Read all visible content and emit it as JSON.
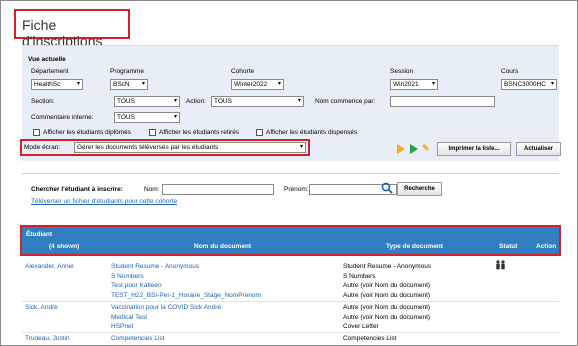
{
  "page": {
    "title": "Fiche d'inscriptions"
  },
  "filters": {
    "section_title": "Vue actuelle",
    "departement_label": "Département",
    "departement_value": "HealthSc",
    "programme_label": "Programme",
    "programme_value": "BScN",
    "cohorte_label": "Cohorte",
    "cohorte_value": "Winter2022",
    "session_label": "Session",
    "session_value": "Win2021",
    "cours_label": "Cours",
    "cours_value": "BSNC3000HC",
    "section_label": "Section:",
    "section_value": "TOUS",
    "action_label": "Action:",
    "action_value": "TOUS",
    "nom_commence_label": "Nom commence par:",
    "nom_commence_value": "",
    "commentaire_label": "Commentaire interne:",
    "commentaire_value": "TOUS",
    "chk_diplomes": "Afficher les étudiants diplômés",
    "chk_retires": "Afficher les étudiants retirés",
    "chk_dispenses": "Afficher les étudiants dispensés",
    "mode_label": "Mode écran:",
    "mode_value": "Gérer les documents téléversés par les étudiants",
    "print_button": "Imprimer la liste...",
    "refresh_button": "Actualiser"
  },
  "search": {
    "title": "Chercher l'étudiant à inscrire:",
    "nom_label": "Nom:",
    "prenom_label": "Prénom:",
    "search_button": "Recherche",
    "upload_link": "Téléverser un fichier d'étudiants pour cette cohorte"
  },
  "grid": {
    "header_student": "Étudiant",
    "shown_count": "(4 shown)",
    "col_document": "Nom du document",
    "col_type": "Type de document",
    "col_status": "Statut",
    "col_actions": "Action",
    "rows": [
      {
        "student": "Alexander, Annie",
        "docs": [
          "Student Resume - Anonymous",
          "S Numbers",
          "Test pour Katleen",
          "TEST_H22_BSI-Per-1_Horaire_Stage_NomPrenom"
        ],
        "types": [
          "Student Resume - Anonymous",
          "S Numbers",
          "Autre (voir Nom du document)",
          "Autre (voir Nom du document)"
        ]
      },
      {
        "student": "Sick, Andre",
        "docs": [
          "Vaccination pour la COVID Sick André",
          "Medical Test",
          "HSPnet"
        ],
        "types": [
          "Autre (voir Nom du document)",
          "Autre (voir Nom du document)",
          "Cover Letter"
        ]
      },
      {
        "student": "Trudeau, Justin",
        "docs": [
          "Competencies List"
        ],
        "types": [
          "Competencies List"
        ]
      }
    ]
  },
  "colors": {
    "accent_blue": "#2f7fc1",
    "link_blue": "#1f63b5",
    "highlight_red": "#d3202a",
    "panel_bg": "#e8eef8"
  }
}
